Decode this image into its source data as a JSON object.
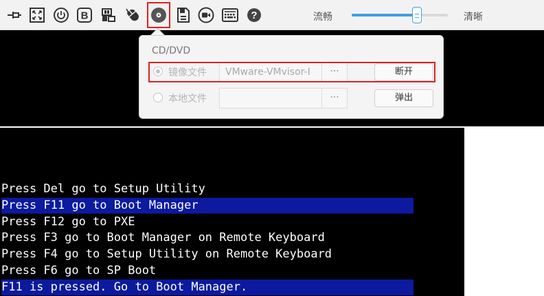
{
  "toolbar": {
    "icons": [
      {
        "name": "pin-icon"
      },
      {
        "name": "fullscreen-icon"
      },
      {
        "name": "power-icon"
      },
      {
        "name": "boot-b-icon"
      },
      {
        "name": "media-library-icon"
      },
      {
        "name": "mouse-icon"
      },
      {
        "name": "cd-dvd-icon"
      },
      {
        "name": "floppy-icon"
      },
      {
        "name": "record-icon"
      },
      {
        "name": "keyboard-icon"
      },
      {
        "name": "help-icon"
      }
    ],
    "quality_low_label": "流畅",
    "quality_high_label": "清晰",
    "quality_slider_value": 0.68,
    "accent_color": "#3ba0e6",
    "highlight_color": "#e02020"
  },
  "popup": {
    "title": "CD/DVD",
    "image_option_label": "镜像文件",
    "image_path_value": "VMware-VMvisor-I",
    "local_option_label": "本地文件",
    "local_path_value": "",
    "browse_label": "···",
    "disconnect_label": "断开",
    "eject_label": "弹出"
  },
  "console": {
    "lines": [
      {
        "text": "Press Del go to Setup Utility",
        "highlighted": false
      },
      {
        "text": "Press F11 go to Boot Manager",
        "highlighted": true
      },
      {
        "text": "Press F12 go to PXE",
        "highlighted": false
      },
      {
        "text": "Press F3 go to Boot Manager on Remote Keyboard",
        "highlighted": false
      },
      {
        "text": "Press F4 go to Setup Utility on Remote Keyboard",
        "highlighted": false
      },
      {
        "text": "Press F6 go to SP Boot",
        "highlighted": false
      },
      {
        "text": "F11 is pressed. Go to Boot Manager.",
        "highlighted": true
      }
    ],
    "highlight_color": "#0b1a9e"
  }
}
